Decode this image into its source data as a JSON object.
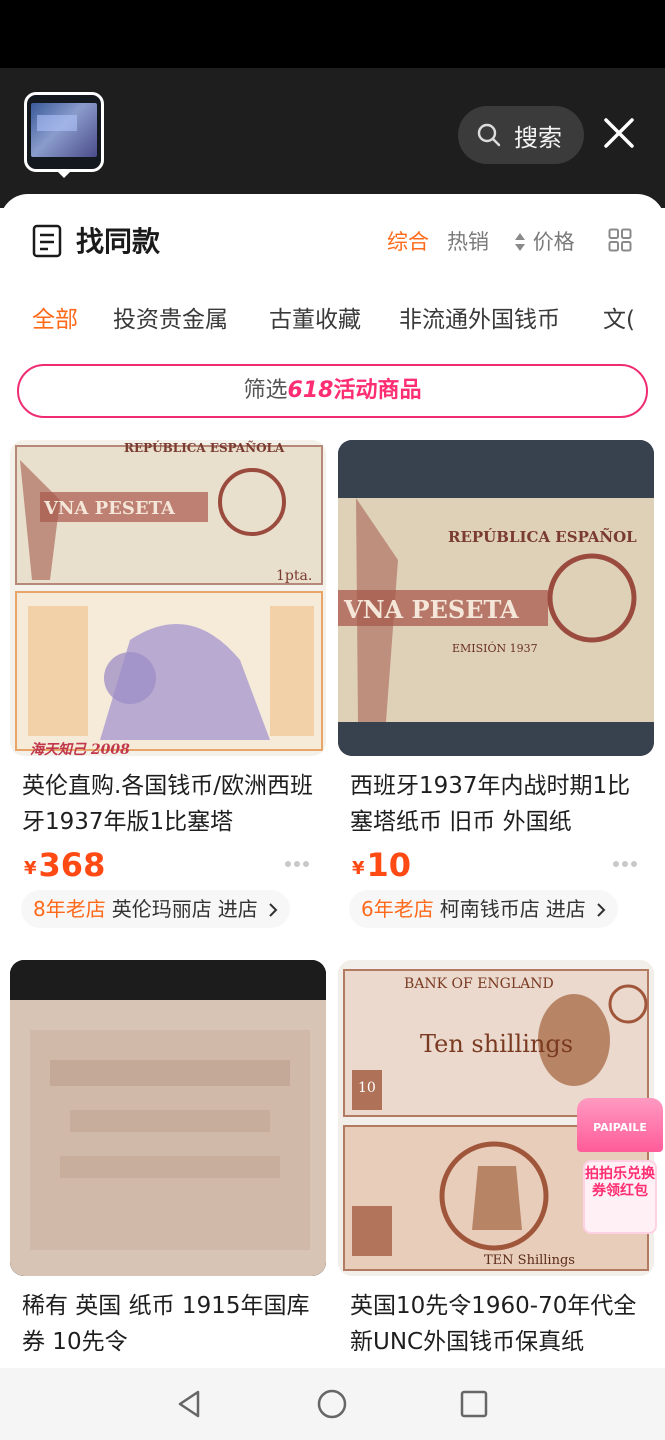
{
  "header": {
    "search_label": "搜索",
    "title": "找同款",
    "sort_tabs": [
      {
        "label": "综合",
        "active": true
      },
      {
        "label": "热销",
        "active": false
      },
      {
        "label": "价格",
        "active": false
      }
    ],
    "layout_toggle_icon": "grid-icon"
  },
  "categories": [
    {
      "label": "全部",
      "active": true
    },
    {
      "label": "投资贵金属",
      "active": false
    },
    {
      "label": "古董收藏",
      "active": false
    },
    {
      "label": "非流通外国钱币",
      "active": false
    },
    {
      "label": "文(",
      "active": false
    }
  ],
  "filter": {
    "prefix": "筛选",
    "number": "618",
    "suffix": "活动商品"
  },
  "products": [
    {
      "title": "英伦直购.各国钱币/欧洲西班牙1937年版1比塞塔",
      "currency": "¥",
      "price": "368",
      "shop_age": "8年老店",
      "shop_name": "英伦玛丽店",
      "enter_label": "进店",
      "image_texts": [
        "REPÚBLICA ESPAÑOLA",
        "VNA PESETA",
        "1pta.",
        "海天知己 2008"
      ]
    },
    {
      "title": "西班牙1937年内战时期1比塞塔纸币 旧币 外国纸",
      "currency": "¥",
      "price": "10",
      "shop_age": "6年老店",
      "shop_name": "柯南钱币店",
      "enter_label": "进店",
      "image_texts": [
        "REPÚBLICA ESPAÑOL",
        "VNA PESETA",
        "EMISIÓN 1937"
      ]
    },
    {
      "title": "稀有 英国 纸币 1915年国库券 10先令",
      "image_texts": []
    },
    {
      "title": "英国10先令1960-70年代全新UNC外国钱币保真纸",
      "image_texts": [
        "BANK OF ENGLAND",
        "Ten shillings",
        "10",
        "TEN Shillings"
      ]
    }
  ],
  "promo": {
    "brand": "PAIPAILE",
    "text": "拍拍乐兑换券领红包"
  },
  "colors": {
    "accent": "#ff6a1a",
    "price": "#ff4a14",
    "filter_pink": "#ef2b72"
  }
}
